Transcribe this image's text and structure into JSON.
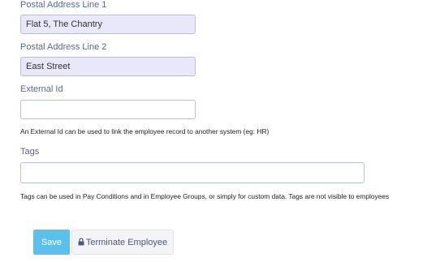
{
  "form": {
    "address_line1": {
      "label": "Postal Address Line 1",
      "value": "Flat 5, The Chantry"
    },
    "address_line2": {
      "label": "Postal Address Line 2",
      "value": "East Street"
    },
    "external_id": {
      "label": "External Id",
      "value": "",
      "help": "An External Id can be used to link the employee record to another system (eg: HR)"
    },
    "tags": {
      "label": "Tags",
      "value": "",
      "help": "Tags can be used in Pay Conditions and in Employee Groups, or simply for custom data. Tags are not visible to employees"
    }
  },
  "actions": {
    "save_label": "Save",
    "terminate_label": "Terminate Employee",
    "terminate_icon": "lock-icon"
  },
  "colors": {
    "save_button": "#5bc0eb",
    "filled_input_bg": "#e8e8fa",
    "input_border": "#b9bedd"
  }
}
